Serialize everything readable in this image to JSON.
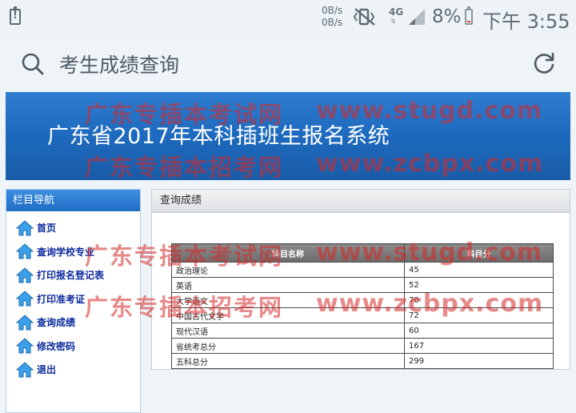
{
  "status_bar": {
    "net_speed_up": "0B/s",
    "net_speed_down": "0B/s",
    "network": "4G",
    "network_arrows": "⇅",
    "battery": "8%",
    "time": "下午 3:55",
    "battery_color": "#e2433b"
  },
  "header": {
    "title": "考生成绩查询",
    "left_icon": "search-icon",
    "right_icon": "refresh-icon"
  },
  "banner": {
    "title": "广东省2017年本科插班生报名系统"
  },
  "watermarks": {
    "line1_cn": "广东专插本考试网",
    "line1_url": "www.stugd.com",
    "line2_cn": "广东专插本招考网",
    "line2_url": "www.zcbpx.com"
  },
  "sidebar": {
    "title": "栏目导航",
    "items": [
      {
        "label": "首页"
      },
      {
        "label": "查询学校专业"
      },
      {
        "label": "打印报名登记表"
      },
      {
        "label": "打印准考证"
      },
      {
        "label": "查询成绩"
      },
      {
        "label": "修改密码"
      },
      {
        "label": "退出"
      }
    ]
  },
  "main": {
    "panel_title": "查询成绩",
    "table": {
      "headers": [
        "科目名称",
        "科目分"
      ],
      "rows": [
        {
          "subject": "政治理论",
          "score": "45"
        },
        {
          "subject": "英语",
          "score": "52"
        },
        {
          "subject": "大学语文",
          "score": "70"
        },
        {
          "subject": "中国古代文学",
          "score": "72"
        },
        {
          "subject": "现代汉语",
          "score": "60"
        },
        {
          "subject": "省统考总分",
          "score": "167"
        },
        {
          "subject": "五科总分",
          "score": "299"
        }
      ]
    }
  },
  "colors": {
    "banner": "#1e6bc0",
    "nav_link": "#0c2a9e",
    "watermark": "#d62828"
  }
}
